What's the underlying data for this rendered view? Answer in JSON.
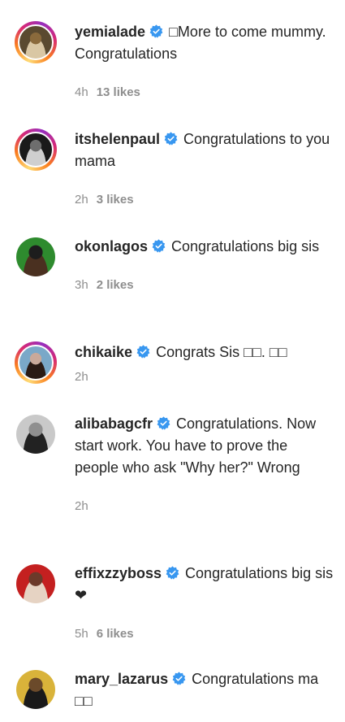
{
  "comments": [
    {
      "username": "yemialade",
      "text": "□More to come mummy. Congratulations",
      "time": "4h",
      "likes": "13 likes",
      "avatar_style": "story",
      "avatar_colors": [
        "#5a4a30",
        "#d9c7a4",
        "#8a6a3c"
      ]
    },
    {
      "username": "itshelenpaul",
      "text": "Congratulations to you mama",
      "time": "2h",
      "likes": "3 likes",
      "avatar_style": "story",
      "avatar_colors": [
        "#1a1a1a",
        "#cfcfcf",
        "#6e6e6e"
      ]
    },
    {
      "username": "okonlagos",
      "text": "Congratulations big sis",
      "time": "3h",
      "likes": "2 likes",
      "avatar_style": "plain",
      "avatar_colors": [
        "#2e8b2e",
        "#4a3020",
        "#1d1d1d"
      ]
    },
    {
      "username": "chikaike",
      "text": "Congrats Sis □□. □□",
      "time": "2h",
      "likes": "",
      "avatar_style": "story",
      "avatar_colors": [
        "#7aa8c8",
        "#2a1a14",
        "#c9a99a"
      ]
    },
    {
      "username": "alibabagcfr",
      "text": "Congratulations. Now start work. You have to prove the people who ask \"Why her?\" Wrong",
      "time": "2h",
      "likes": "",
      "avatar_style": "plain",
      "avatar_colors": [
        "#c9c9c9",
        "#222222",
        "#8f8f8f"
      ]
    },
    {
      "username": "effixzzyboss",
      "text": "Congratulations big sis❤",
      "time": "5h",
      "likes": "6 likes",
      "avatar_style": "plain",
      "avatar_colors": [
        "#c42020",
        "#e6d3c3",
        "#6b3a2a"
      ]
    },
    {
      "username": "mary_lazarus",
      "text": "Congratulations ma □□",
      "time": "",
      "likes": "",
      "avatar_style": "plain",
      "avatar_colors": [
        "#d9b33a",
        "#1a1a1a",
        "#6b4a2a"
      ]
    }
  ],
  "verified_color": "#3897f0"
}
